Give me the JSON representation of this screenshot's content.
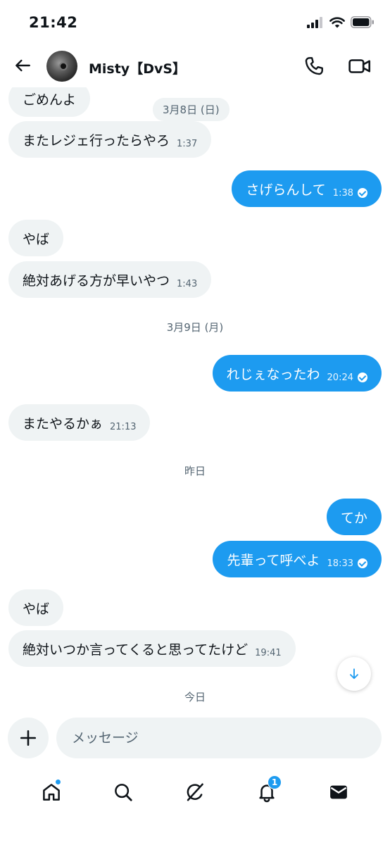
{
  "status_bar": {
    "time": "21:42"
  },
  "header": {
    "contact_name": "Misty【DvS】"
  },
  "messages": [
    {
      "dir": "in",
      "text": "ごめんよ",
      "time": ""
    },
    {
      "dir": "in",
      "text": "またレジェ行ったらやろ",
      "time": "1:37"
    },
    {
      "dir": "out",
      "text": "さげらんして",
      "time": "1:38"
    },
    {
      "dir": "in",
      "text": "やば",
      "time": ""
    },
    {
      "dir": "in",
      "text": "絶対あげる方が早いやつ",
      "time": "1:43"
    },
    {
      "dir": "out",
      "text": "れじぇなったわ",
      "time": "20:24"
    },
    {
      "dir": "in",
      "text": "またやるかぁ",
      "time": "21:13"
    },
    {
      "dir": "out",
      "text": "てか",
      "time": ""
    },
    {
      "dir": "out",
      "text": "先輩って呼べよ",
      "time": "18:33"
    },
    {
      "dir": "in",
      "text": "やば",
      "time": ""
    },
    {
      "dir": "in",
      "text": "絶対いつか言ってくると思ってたけど",
      "time": "19:41"
    }
  ],
  "date_separators": [
    "3月8日 (日)",
    "3月9日 (月)",
    "昨日",
    "今日"
  ],
  "composer": {
    "placeholder": "メッセージ"
  },
  "nav": {
    "notifications_badge": "1"
  },
  "icons": {
    "back": "back-arrow-icon",
    "call": "phone-icon",
    "video": "video-camera-icon",
    "plus": "plus-icon",
    "scroll": "arrow-down-icon",
    "home": "home-icon",
    "search": "search-icon",
    "grok": "grok-icon",
    "notifications": "bell-icon",
    "messages": "envelope-icon"
  },
  "colors": {
    "accent": "#1d9bf0",
    "incoming_bubble": "#eff3f4",
    "text": "#0f1419",
    "muted": "#536471"
  }
}
